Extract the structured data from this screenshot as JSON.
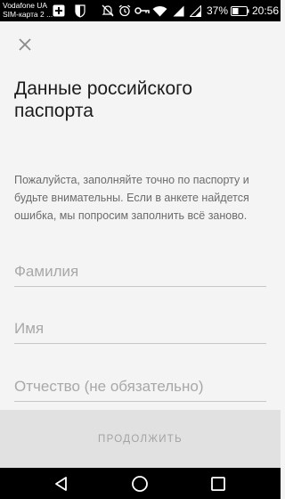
{
  "status_bar": {
    "carrier_line1": "Vodafone UA",
    "carrier_line2": "SIM-карта 2 ...",
    "battery_percent": "37%",
    "time": "20:56",
    "icons": [
      "add-notification-icon",
      "shield-icon",
      "mute-icon",
      "alarm-icon",
      "key-icon",
      "wifi-icon",
      "signal-icon",
      "signal-icon",
      "battery-icon"
    ]
  },
  "screen": {
    "title": "Данные российского паспорта",
    "description": "Пожалуйста, заполняйте точно по паспорту и будьте внимательны. Если в анкете найдется ошибка, мы попросим заполнить всё заново.",
    "fields": {
      "surname_placeholder": "Фамилия",
      "name_placeholder": "Имя",
      "patronymic_placeholder": "Отчество (не обязательно)"
    },
    "continue_label": "ПРОДОЛЖИТЬ"
  },
  "nav_bar": {
    "icons": [
      "back-icon",
      "home-icon",
      "recents-icon"
    ]
  }
}
